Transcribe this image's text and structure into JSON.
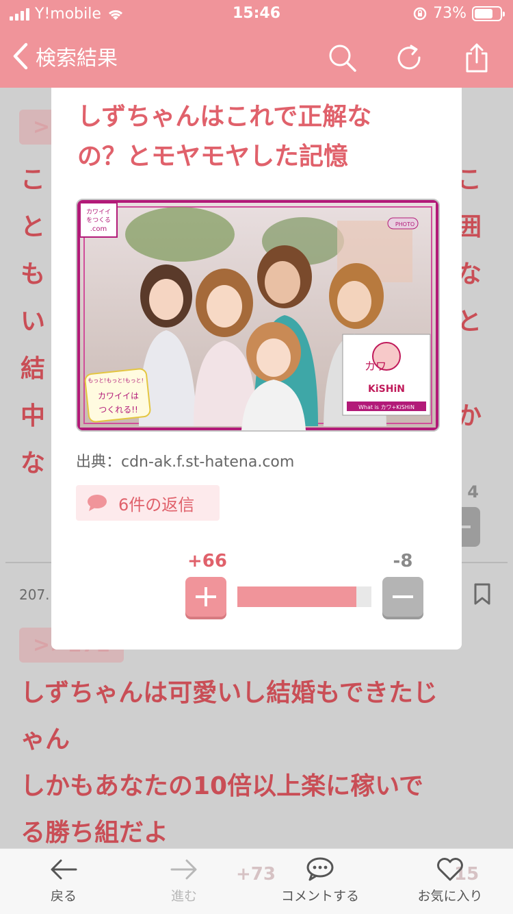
{
  "status_bar": {
    "carrier": "Y!mobile",
    "time": "15:46",
    "battery": "73%",
    "battery_level": 0.73
  },
  "nav": {
    "back_label": "検索結果",
    "icons": [
      "search-icon",
      "refresh-icon",
      "share-icon"
    ]
  },
  "background": {
    "anchor1": ">",
    "comment_fragment_lines": [
      "こ",
      "と",
      "も",
      "い",
      "結",
      "中",
      "な"
    ],
    "right_chars": [
      "こ",
      "囲",
      "な",
      "と",
      "",
      "か"
    ],
    "count_right": "4",
    "comment_no": "207.",
    "anchor2": ">>171",
    "reply_body": [
      "しずちゃんは可愛いし結婚もできたじ",
      "ゃん",
      "しかもあなたの10倍以上楽に稼いで",
      "る勝ち組だよ"
    ],
    "hidden_plus": "+73",
    "hidden_minus": "15"
  },
  "modal": {
    "title_lines": [
      "しずちゃんはこれで正解な",
      "の？とモヤモヤした記憶"
    ],
    "image_alt": "カワイイをつくる.com / カワ+KiSHiN",
    "image_texts": {
      "logo": "カワイイをつくる.com",
      "photo_badge": "PHOTO",
      "kishin": "KiSHiN",
      "kawa": "カワ",
      "tagline": "もっと!もっと!もっと!",
      "kawaii": "カワイイは つくれる!!",
      "what_is": "What is カワ+KiSHiN"
    },
    "source": "出典：cdn-ak.f.st-hatena.com",
    "reply_label": "6件の返信",
    "plus_count": "+66",
    "minus_count": "-8",
    "vote_ratio": 0.89,
    "colors": {
      "accent": "#e0616b",
      "nav": "#f0949a"
    }
  },
  "tabbar": {
    "items": [
      {
        "label": "戻る",
        "icon": "back-arrow-icon",
        "enabled": true
      },
      {
        "label": "進む",
        "icon": "forward-arrow-icon",
        "enabled": false
      },
      {
        "label": "コメントする",
        "icon": "comment-icon",
        "enabled": true
      },
      {
        "label": "お気に入り",
        "icon": "heart-icon",
        "enabled": true
      }
    ]
  }
}
